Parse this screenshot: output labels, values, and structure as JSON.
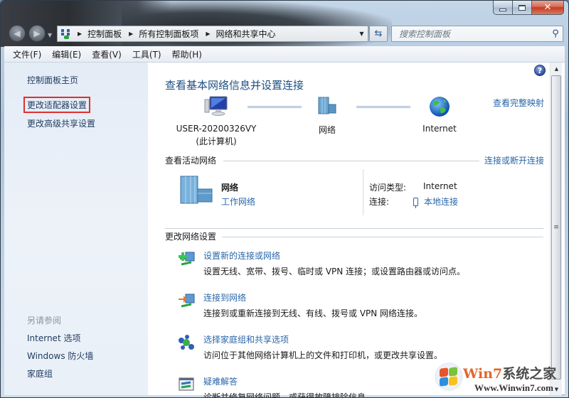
{
  "window": {
    "caption": {
      "minimize": "minimize",
      "maximize": "maximize",
      "close": "✕"
    }
  },
  "navigation": {
    "breadcrumb": [
      "控制面板",
      "所有控制面板项",
      "网络和共享中心"
    ],
    "search_placeholder": "搜索控制面板"
  },
  "menubar": {
    "items": [
      "文件(F)",
      "编辑(E)",
      "查看(V)",
      "工具(T)",
      "帮助(H)"
    ]
  },
  "sidebar": {
    "links": [
      {
        "label": "控制面板主页",
        "highlighted": false
      },
      {
        "label": "更改适配器设置",
        "highlighted": true
      },
      {
        "label": "更改高级共享设置",
        "highlighted": false
      }
    ],
    "see_also_heading": "另请参阅",
    "see_also": [
      "Internet 选项",
      "Windows 防火墙",
      "家庭组"
    ]
  },
  "main": {
    "title": "查看基本网络信息并设置连接",
    "view_full_map": "查看完整映射",
    "network_map": {
      "computer_name": "USER-20200326VY",
      "computer_caption": "(此计算机)",
      "network": "网络",
      "internet": "Internet"
    },
    "active_networks": {
      "heading": "查看活动网络",
      "connect_link": "连接或断开连接",
      "network_name": "网络",
      "network_type": "工作网络",
      "access_type_label": "访问类型:",
      "access_type_value": "Internet",
      "connection_label": "连接:",
      "connection_value": "本地连接"
    },
    "change_settings": {
      "heading": "更改网络设置",
      "tasks": [
        {
          "icon": "new-connection-icon",
          "title": "设置新的连接或网络",
          "description": "设置无线、宽带、拨号、临时或 VPN 连接；或设置路由器或访问点。"
        },
        {
          "icon": "connect-network-icon",
          "title": "连接到网络",
          "description": "连接到或重新连接到无线、有线、拨号或 VPN 网络连接。"
        },
        {
          "icon": "homegroup-icon",
          "title": "选择家庭组和共享选项",
          "description": "访问位于其他网络计算机上的文件和打印机，或更改共享设置。"
        },
        {
          "icon": "troubleshoot-icon",
          "title": "疑难解答",
          "description": "诊断并修复网络问题，或获得故障排除信息。"
        }
      ]
    }
  },
  "watermark": {
    "brand_latin": "Win7",
    "brand_cn": "系统之家",
    "url": "Www.Winwin7.com"
  },
  "colors": {
    "link": "#2a66a8",
    "title": "#1e4e82",
    "highlight_box": "#e03030"
  }
}
